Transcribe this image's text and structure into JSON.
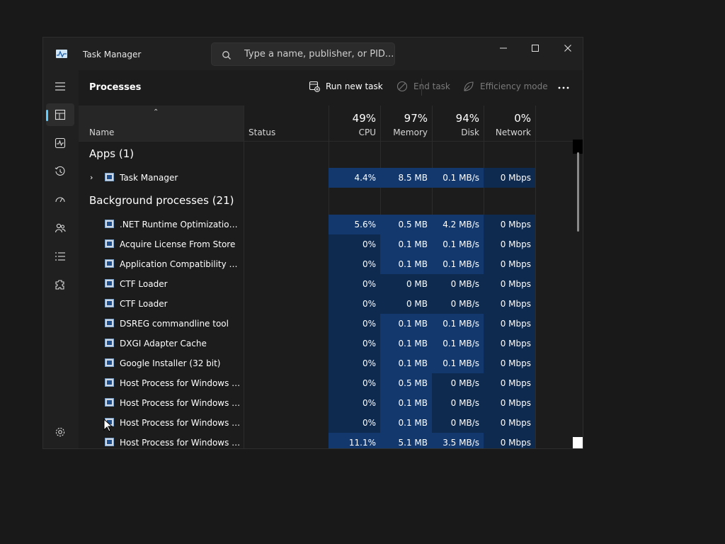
{
  "window": {
    "title": "Task Manager"
  },
  "search": {
    "placeholder": "Type a name, publisher, or PID..."
  },
  "window_controls": {
    "minimize": "—",
    "maximize": "☐",
    "close": "✕"
  },
  "page": {
    "title": "Processes"
  },
  "commands": {
    "run_new_task": "Run new task",
    "end_task": "End task",
    "efficiency_mode": "Efficiency mode"
  },
  "columns": {
    "name": "Name",
    "status": "Status",
    "cpu": {
      "pct": "49%",
      "label": "CPU"
    },
    "memory": {
      "pct": "97%",
      "label": "Memory"
    },
    "disk": {
      "pct": "94%",
      "label": "Disk"
    },
    "network": {
      "pct": "0%",
      "label": "Network"
    }
  },
  "groups": {
    "apps": "Apps (1)",
    "background": "Background processes (21)"
  },
  "apps": [
    {
      "name": "Task Manager",
      "cpu": "4.4%",
      "memory": "8.5 MB",
      "disk": "0.1 MB/s",
      "network": "0 Mbps"
    }
  ],
  "processes": [
    {
      "name": ".NET Runtime Optimization Se...",
      "cpu": "5.6%",
      "memory": "0.5 MB",
      "disk": "4.2 MB/s",
      "network": "0 Mbps",
      "icon": "service-icon"
    },
    {
      "name": "Acquire License From Store",
      "cpu": "0%",
      "memory": "0.1 MB",
      "disk": "0.1 MB/s",
      "network": "0 Mbps",
      "icon": "service-icon"
    },
    {
      "name": "Application Compatibility Dat...",
      "cpu": "0%",
      "memory": "0.1 MB",
      "disk": "0.1 MB/s",
      "network": "0 Mbps",
      "icon": "service-icon"
    },
    {
      "name": "CTF Loader",
      "cpu": "0%",
      "memory": "0 MB",
      "disk": "0 MB/s",
      "network": "0 Mbps",
      "icon": "service-icon"
    },
    {
      "name": "CTF Loader",
      "cpu": "0%",
      "memory": "0 MB",
      "disk": "0 MB/s",
      "network": "0 Mbps",
      "icon": "service-icon"
    },
    {
      "name": "DSREG commandline tool",
      "cpu": "0%",
      "memory": "0.1 MB",
      "disk": "0.1 MB/s",
      "network": "0 Mbps",
      "icon": "service-icon"
    },
    {
      "name": "DXGI Adapter Cache",
      "cpu": "0%",
      "memory": "0.1 MB",
      "disk": "0.1 MB/s",
      "network": "0 Mbps",
      "icon": "service-icon"
    },
    {
      "name": "Google Installer (32 bit)",
      "cpu": "0%",
      "memory": "0.1 MB",
      "disk": "0.1 MB/s",
      "network": "0 Mbps",
      "icon": "installer-icon"
    },
    {
      "name": "Host Process for Windows Tasks",
      "cpu": "0%",
      "memory": "0.5 MB",
      "disk": "0 MB/s",
      "network": "0 Mbps",
      "icon": "service-icon"
    },
    {
      "name": "Host Process for Windows Tasks",
      "cpu": "0%",
      "memory": "0.1 MB",
      "disk": "0 MB/s",
      "network": "0 Mbps",
      "icon": "service-icon"
    },
    {
      "name": "Host Process for Windows Tasks",
      "cpu": "0%",
      "memory": "0.1 MB",
      "disk": "0 MB/s",
      "network": "0 Mbps",
      "icon": "service-icon"
    },
    {
      "name": "Host Process for Windows Tasks",
      "cpu": "11.1%",
      "memory": "5.1 MB",
      "disk": "3.5 MB/s",
      "network": "0 Mbps",
      "icon": "service-icon"
    }
  ],
  "nav": [
    {
      "name": "hamburger-menu-icon"
    },
    {
      "name": "processes-icon"
    },
    {
      "name": "performance-icon"
    },
    {
      "name": "app-history-icon"
    },
    {
      "name": "startup-apps-icon"
    },
    {
      "name": "users-icon"
    },
    {
      "name": "details-icon"
    },
    {
      "name": "services-icon"
    },
    {
      "name": "settings-icon"
    }
  ],
  "colors": {
    "accent": "#60cdff",
    "heat_low": "#0e2a4f",
    "heat_high": "#12386e",
    "background": "#202020"
  }
}
